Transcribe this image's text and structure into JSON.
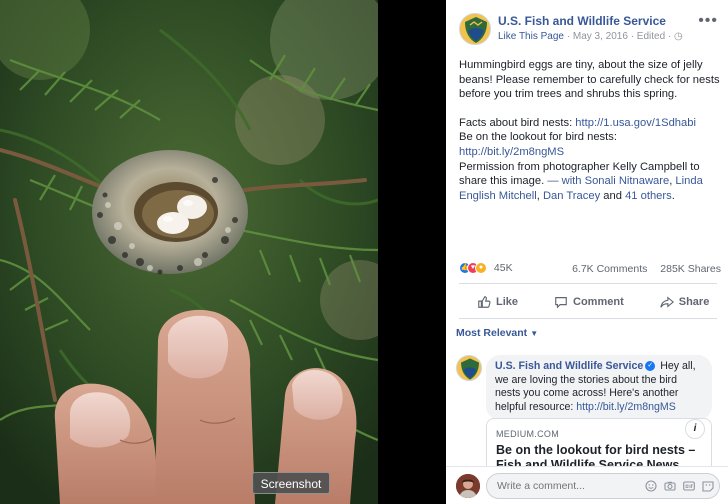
{
  "tooltip": "Screenshot",
  "post": {
    "page_name": "U.S. Fish and Wildlife Service",
    "like_page": "Like This Page",
    "date": "May 3, 2016",
    "edited": "Edited",
    "paragraph1": "Hummingbird eggs are tiny, about the size of jelly beans! Please remember to carefully check for nests before you trim trees and shrubs this spring.",
    "facts_label": "Facts about bird nests:",
    "facts_link": "http://1.usa.gov/1Sdhabi",
    "lookout_label": "Be on the lookout for bird nests:",
    "lookout_link": "http://bit.ly/2m8ngMS",
    "permission": "Permission from photographer Kelly Campbell to share this image.",
    "with_prefix": "— with",
    "tag1": "Sonali Nitnaware",
    "tag2": "Linda English Mitchell",
    "tag3": "Dan Tracey",
    "and": "and",
    "others": "41 others"
  },
  "stats": {
    "reactions": "45K",
    "comments": "6.7K Comments",
    "shares": "285K Shares"
  },
  "actions": {
    "like": "Like",
    "comment": "Comment",
    "share": "Share"
  },
  "sort": {
    "label": "Most Relevant"
  },
  "comment": {
    "author": "U.S. Fish and Wildlife Service",
    "text": "Hey all, we are loving the stories about the bird nests you come across! Here's another helpful resource:",
    "link": "http://bit.ly/2m8ngMS",
    "preview_site": "MEDIUM.COM",
    "preview_title": "Be on the lookout for bird nests – Fish and Wildlife Service News"
  },
  "composer": {
    "placeholder": "Write a comment..."
  },
  "colors": {
    "link": "#385898",
    "like_blue": "#1877f2"
  }
}
